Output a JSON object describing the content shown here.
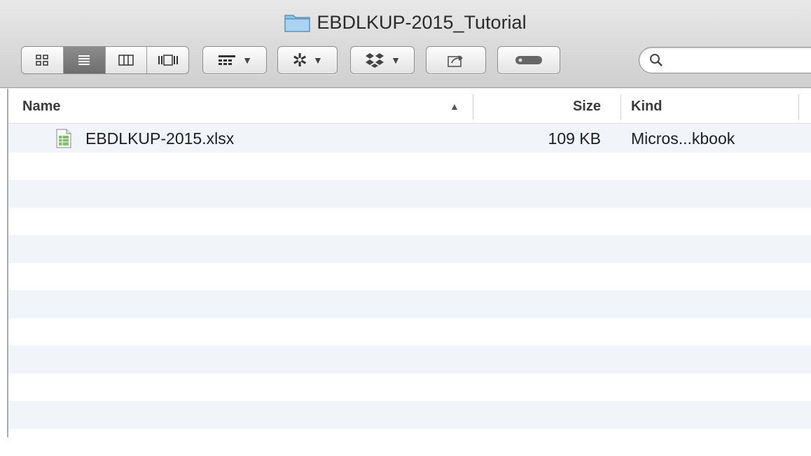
{
  "window": {
    "title": "EBDLKUP-2015_Tutorial",
    "title_icon": "folder-icon"
  },
  "toolbar": {
    "view_modes": [
      "icon-view-icon",
      "list-view-icon",
      "column-view-icon",
      "cover-flow-icon"
    ],
    "active_view": "list-view-icon",
    "arrange_icon": "arrange-icon",
    "action_icon": "gear-icon",
    "dropbox_icon": "dropbox-icon",
    "share_icon": "share-icon",
    "tags_icon": "tag-icon",
    "search_placeholder": ""
  },
  "columns": {
    "name": "Name",
    "size": "Size",
    "kind": "Kind",
    "sort_indicator": "▲"
  },
  "files": [
    {
      "name": "EBDLKUP-2015.xlsx",
      "size": "109 KB",
      "kind": "Micros...kbook",
      "icon": "spreadsheet-icon"
    }
  ],
  "colors": {
    "stripe": "#f1f5fa",
    "toolbar_top": "#e9e9e9",
    "toolbar_bottom": "#cfcfcf"
  }
}
